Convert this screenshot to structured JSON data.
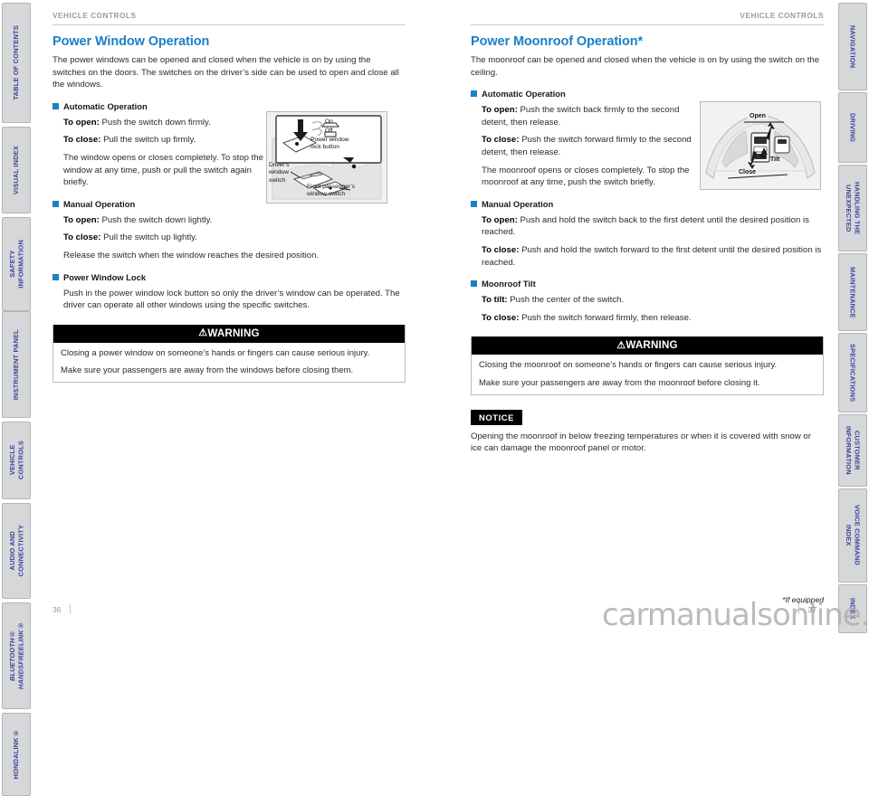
{
  "document": {
    "watermark": "carmanualsonline.info",
    "footnote": "*If equipped",
    "left_page_number": "36",
    "right_page_number": "37"
  },
  "left_rail": {
    "tabs": [
      {
        "label": "TABLE OF CONTENTS",
        "italic": false
      },
      {
        "label": "VISUAL INDEX",
        "italic": false
      },
      {
        "label": "SAFETY\nINFORMATION",
        "italic": false
      },
      {
        "label": "INSTRUMENT PANEL",
        "italic": false
      },
      {
        "label": "VEHICLE\nCONTROLS",
        "italic": false
      },
      {
        "label": "AUDIO AND\nCONNECTIVITY",
        "italic": false
      },
      {
        "label": "BLUETOOTH®\nHANDSFREELINK®",
        "italic": true
      },
      {
        "label": "HONDALINK®",
        "italic": false
      }
    ]
  },
  "right_rail": {
    "tabs": [
      {
        "label": "NAVIGATION"
      },
      {
        "label": "DRIVING"
      },
      {
        "label": "HANDLING THE\nUNEXPECTED"
      },
      {
        "label": "MAINTENANCE"
      },
      {
        "label": "SPECIFICATIONS"
      },
      {
        "label": "CUSTOMER\nINFORMATION"
      },
      {
        "label": "VOICE COMMAND\nINDEX"
      },
      {
        "label": "INDEX"
      }
    ]
  },
  "left_column": {
    "running_head": "VEHICLE CONTROLS",
    "title": "Power Window Operation",
    "intro": "The power windows can be opened and closed when the vehicle is on by using the switches on the doors. The switches on the driver’s side can be used to open and close all the windows.",
    "section_automatic": "Automatic Operation",
    "auto_open_label": "To open:",
    "auto_open_text": " Push the switch down firmly.",
    "auto_close_label": "To close:",
    "auto_close_text": " Pull the switch up firmly.",
    "auto_note": "The window opens or closes completely. To stop the window at any time, push or pull the switch again briefly.",
    "section_manual": "Manual Operation",
    "man_open_label": "To open:",
    "man_open_text": " Push the switch down lightly.",
    "man_close_label": "To close:",
    "man_close_text": " Pull the switch up lightly.",
    "man_note": "Release the switch when the window reaches the desired position.",
    "section_lock": "Power Window Lock",
    "lock_text": "Push in the power window lock button so only the driver’s window can be operated. The driver can operate all other windows using the specific switches.",
    "warning": {
      "symbol": "⚠",
      "heading": "WARNING",
      "lines": [
        "Closing a power window on someone’s hands or fingers can cause serious injury.",
        "Make sure your passengers are away from the windows before closing them."
      ]
    },
    "figure": {
      "name": "power-window-switch-illustration",
      "callouts": [
        "On",
        "Off",
        "Power window\nlock button",
        "Driver’s\nwindow\nswitch",
        "Front passenger’s\nwindow switch"
      ]
    }
  },
  "right_column": {
    "running_head": "VEHICLE CONTROLS",
    "title": "Power Moonroof Operation*",
    "intro": "The moonroof can be opened and closed when the vehicle is on by using the switch on the ceiling.",
    "section_automatic": "Automatic Operation",
    "auto_open_label": "To open:",
    "auto_open_text": " Push the switch back firmly to the second detent, then release.",
    "auto_close_label": "To close:",
    "auto_close_text": " Push the switch forward firmly to the second detent, then release.",
    "auto_note": "The moonroof opens or closes completely. To stop the moonroof at any time, push the switch briefly.",
    "section_manual": "Manual Operation",
    "man_open_label": "To open:",
    "man_open_text": " Push and hold the switch back to the first detent until the desired position is reached.",
    "man_close_label": "To close:",
    "man_close_text": " Push and hold the switch forward to the first detent until the desired position is reached.",
    "section_tilt": "Moonroof Tilt",
    "tilt_label": "To tilt:",
    "tilt_text": " Push the center of the switch.",
    "tilt_close_label": "To close:",
    "tilt_close_text": " Push the switch forward firmly, then release.",
    "warning": {
      "symbol": "⚠",
      "heading": "WARNING",
      "lines": [
        "Closing the moonroof on someone’s hands or fingers can cause serious injury.",
        "Make sure your passengers are away from the moonroof before closing it."
      ]
    },
    "notice": {
      "badge": "NOTICE",
      "text": "Opening the moonroof in below freezing temperatures or when it is covered with snow or ice can damage the moonroof panel or motor."
    },
    "figure": {
      "name": "moonroof-switch-illustration",
      "callouts": [
        "Open",
        "Close",
        "Tilt"
      ]
    }
  },
  "colors": {
    "accent_blue": "#1b80c6",
    "tab_text": "#3a3f9e",
    "tab_bg": "#d6d7d8",
    "runhead_gray": "#9a9a9a",
    "body_text": "#2b2b2b"
  }
}
